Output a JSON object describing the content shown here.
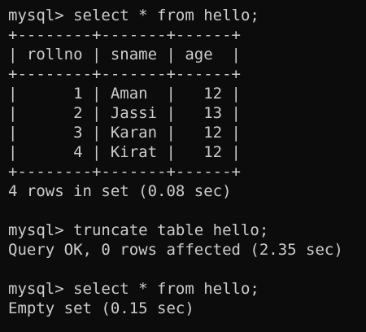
{
  "terminal": {
    "colors": {
      "background": "#0c0c0c",
      "text": "#cccccc"
    },
    "lines": [
      "mysql> select * from hello;",
      "+--------+-------+------+",
      "| rollno | sname | age  |",
      "+--------+-------+------+",
      "|      1 | Aman  |   12 |",
      "|      2 | Jassi |   13 |",
      "|      3 | Karan |   12 |",
      "|      4 | Kirat |   12 |",
      "+--------+-------+------+",
      "4 rows in set (0.08 sec)",
      "",
      "mysql> truncate table hello;",
      "Query OK, 0 rows affected (2.35 sec)",
      "",
      "mysql> select * from hello;",
      "Empty set (0.15 sec)"
    ]
  }
}
